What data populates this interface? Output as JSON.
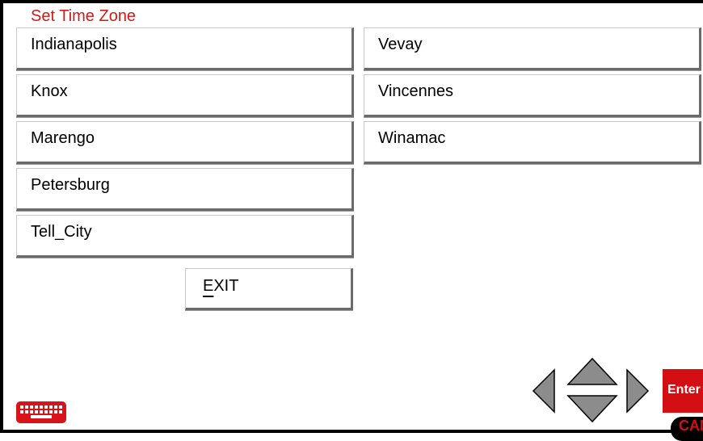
{
  "title": "Set Time Zone",
  "zones": [
    "Indianapolis",
    "Knox",
    "Marengo",
    "Petersburg",
    "Tell_City",
    "Vevay",
    "Vincennes",
    "Winamac"
  ],
  "exit": {
    "mnemonic": "E",
    "rest": "XIT"
  },
  "enter_label": "Enter",
  "cancel_label": "CAN",
  "colors": {
    "accent": "#d40f14",
    "arrow": "#8c8c8c"
  },
  "icons": [
    "keyboard-icon",
    "arrow-left-icon",
    "arrow-up-icon",
    "arrow-down-icon",
    "arrow-right-icon"
  ]
}
